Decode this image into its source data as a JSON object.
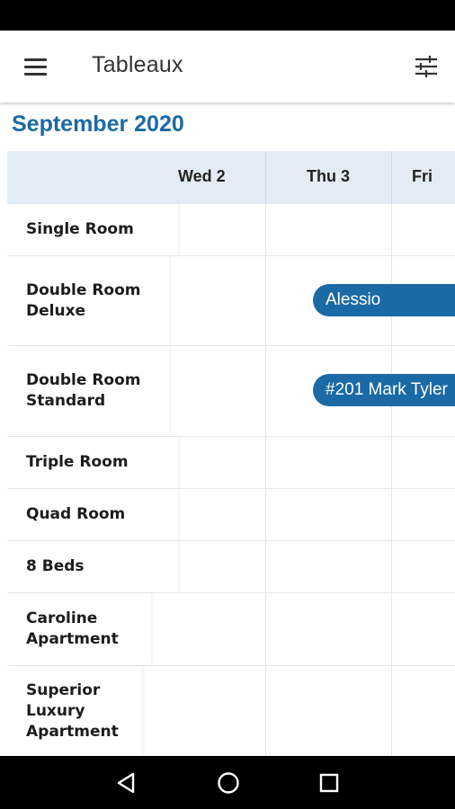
{
  "app_bar": {
    "title": "Tableaux"
  },
  "calendar": {
    "month": "September 2020",
    "days": [
      "Wed 2",
      "Thu 3",
      "Fri"
    ],
    "rooms": [
      {
        "name": "Single Room"
      },
      {
        "name": "Double Room Deluxe"
      },
      {
        "name": "Double Room Standard"
      },
      {
        "name": "Triple Room"
      },
      {
        "name": "Quad Room"
      },
      {
        "name": "8 Beds"
      },
      {
        "name": "Caroline Apartment"
      },
      {
        "name": "Superior Luxury Apartment"
      }
    ],
    "bookings": [
      {
        "label": "Alessio",
        "room": "Double Room Deluxe"
      },
      {
        "label": "#201 Mark Tyler",
        "room": "Double Room Standard"
      }
    ]
  },
  "colors": {
    "accent": "#1b6aa5",
    "header_bg": "#e3ecf5"
  },
  "icons": {
    "menu": "hamburger-menu-icon",
    "filter": "sliders-icon",
    "back": "nav-back-icon",
    "home": "nav-home-icon",
    "recents": "nav-recents-icon"
  }
}
